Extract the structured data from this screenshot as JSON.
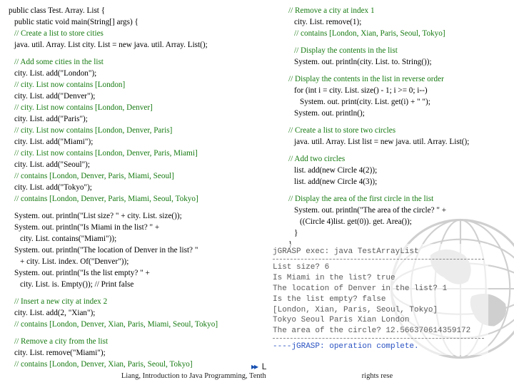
{
  "left": {
    "l0": "public class Test. Array. List {",
    "l1": "public static void main(String[] args) {",
    "c1": "// Create a list to store cities",
    "l2": "java. util. Array. List city. List = new java. util. Array. List();",
    "c2": "// Add some cities in the list",
    "l3": "city. List. add(\"London\");",
    "c3": "// city. List now contains [London]",
    "l4": "city. List. add(\"Denver\");",
    "c4": "// city. List now contains [London, Denver]",
    "l5": "city. List. add(\"Paris\");",
    "c5": "// city. List now contains [London, Denver, Paris]",
    "l6": "city. List. add(\"Miami\");",
    "c6": "// city. List now contains [London, Denver, Paris, Miami]",
    "l7": "city. List. add(\"Seoul\");",
    "c7": "// contains [London, Denver, Paris, Miami, Seoul]",
    "l8": "city. List. add(\"Tokyo\");",
    "c8": "// contains [London, Denver, Paris, Miami, Seoul, Tokyo]",
    "p1": "System. out. println(\"List size? \" + city. List. size());",
    "p2a": "System. out. println(\"Is Miami in the list? \" +",
    "p2b": "city. List. contains(\"Miami\"));",
    "p3a": "System. out. println(\"The location of Denver in the list? \"",
    "p3b": "+ city. List. index. Of(\"Denver\"));",
    "p4a": "System. out. println(\"Is the list empty? \" +",
    "p4b": "city. List. is. Empty()); // Print false",
    "c9": "// Insert a new city at index 2",
    "l9": "city. List. add(2, \"Xian\");",
    "c10": "// contains [London, Denver, Xian, Paris, Miami, Seoul, Tokyo]",
    "c11": "// Remove a city from the list",
    "l10": "city. List. remove(\"Miami\");",
    "c12": "// contains [London, Denver, Xian, Paris, Seoul, Tokyo]"
  },
  "right": {
    "c1": "// Remove a city at index 1",
    "l1": "city. List. remove(1);",
    "c2": "// contains [London, Xian, Paris, Seoul, Tokyo]",
    "c3": "// Display the contents in the list",
    "l2": "System. out. println(city. List. to. String());",
    "c4": "// Display the contents in the list in reverse order",
    "l3": "for (int i = city. List. size() - 1; i >= 0; i--)",
    "l4": "System. out. print(city. List. get(i) + \" \");",
    "l5": "System. out. println();",
    "c5": "// Create a list to store two circles",
    "l6": "java. util. Array. List list = new java. util. Array. List();",
    "c6": "// Add two circles",
    "l7": "list. add(new Circle 4(2));",
    "l8": "list. add(new Circle 4(3));",
    "c7": "// Display the area of the first circle in the list",
    "l9": "System. out. println(\"The area of the circle? \" +",
    "l10": "((Circle 4)list. get(0)). get. Area());",
    "l11": "}",
    "l12": "}"
  },
  "console": {
    "t0": "jGRASP exec: java TestArrayList",
    "t1": "List size? 6",
    "t2": "Is Miami in the list? true",
    "t3": "The location of Denver in the list? 1",
    "t4": "Is the list empty? false",
    "t5": "[London, Xian, Paris, Seoul, Tokyo]",
    "t6": "Tokyo Seoul Paris Xian London",
    "t7": "The area of the circle? 12.566370614359172",
    "t8": "----jGRASP: operation complete."
  },
  "footer": "Liang, Introduction to Java Programming, Tenth                                                   rights rese",
  "marker": "L"
}
